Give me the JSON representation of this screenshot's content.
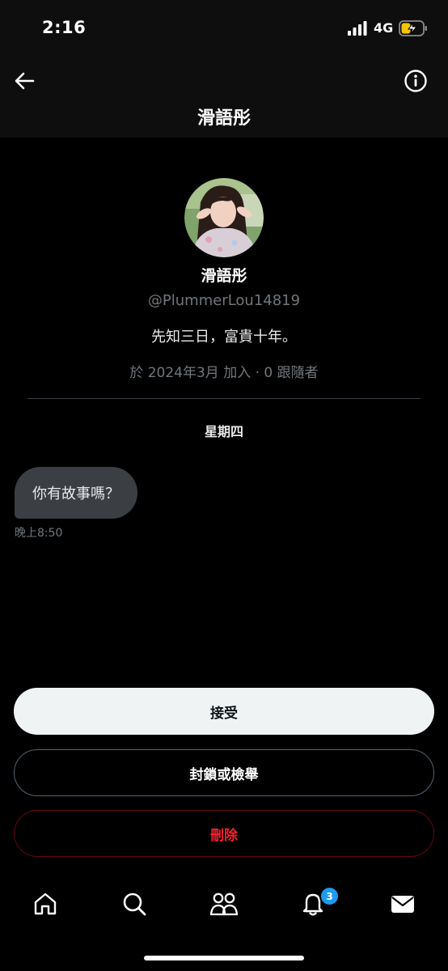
{
  "status_bar": {
    "time": "2:16",
    "network": "4G"
  },
  "header": {
    "title": "滑語彤",
    "back_icon": "arrow-left-icon",
    "info_icon": "info-circle-icon"
  },
  "profile": {
    "name": "滑語彤",
    "handle": "@PlummerLou14819",
    "bio": "先知三日，富貴十年。",
    "meta": "於 2024年3月 加入 · 0 跟隨者"
  },
  "conversation": {
    "day_label": "星期四",
    "messages": [
      {
        "text": "你有故事嗎？",
        "time": "晚上8:50"
      }
    ]
  },
  "actions": {
    "accept_label": "接受",
    "block_label": "封鎖或檢舉",
    "delete_label": "刪除"
  },
  "tab_bar": {
    "items": [
      {
        "icon": "home-icon"
      },
      {
        "icon": "search-icon"
      },
      {
        "icon": "communities-icon"
      },
      {
        "icon": "bell-icon",
        "badge": "3"
      },
      {
        "icon": "mail-icon"
      }
    ]
  },
  "colors": {
    "background": "#000000",
    "accent_blue": "#1d9bf0",
    "delete_red": "#f4212e",
    "bubble": "#3b3f44"
  }
}
